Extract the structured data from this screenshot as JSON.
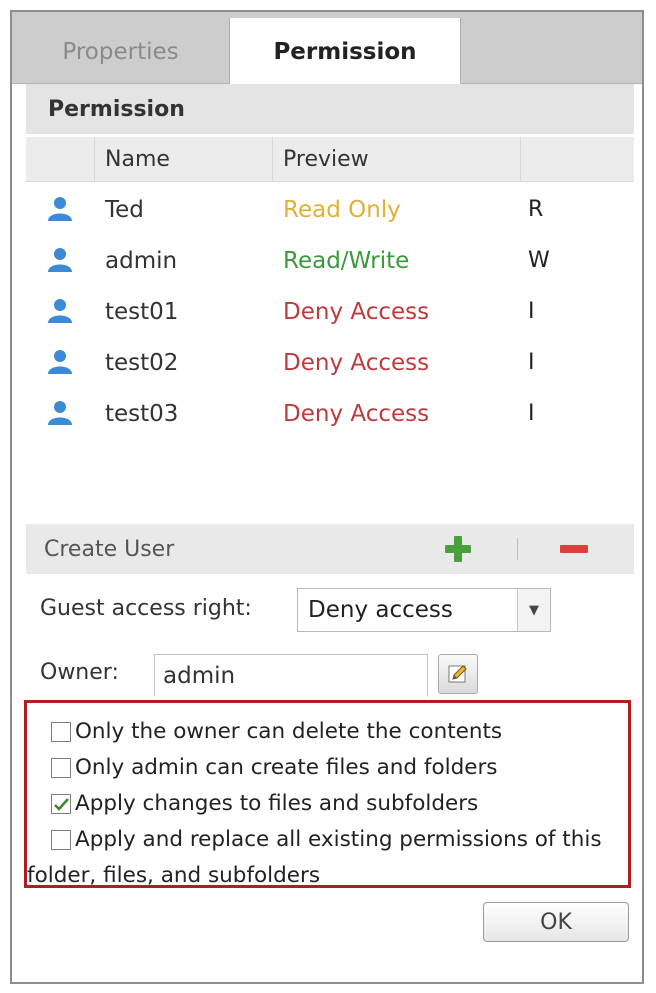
{
  "tabs": [
    {
      "label": "Properties"
    },
    {
      "label": "Permission"
    }
  ],
  "section_title": "Permission",
  "table": {
    "columns": [
      "Name",
      "Preview",
      ""
    ],
    "rows": [
      {
        "name": "Ted",
        "preview": "Read Only",
        "permission": "R",
        "preview_color": "#e0b132"
      },
      {
        "name": "admin",
        "preview": "Read/Write",
        "permission": "W",
        "preview_color": "#3a9a3a"
      },
      {
        "name": "test01",
        "preview": "Deny Access",
        "permission": "I",
        "preview_color": "#c0393b"
      },
      {
        "name": "test02",
        "preview": "Deny Access",
        "permission": "I",
        "preview_color": "#c0393b"
      },
      {
        "name": "test03",
        "preview": "Deny Access",
        "permission": "I",
        "preview_color": "#c0393b"
      }
    ]
  },
  "toolbar": {
    "label": "Create User",
    "add_icon": "plus-icon",
    "remove_icon": "minus-icon"
  },
  "guest_access": {
    "label": "Guest access right:",
    "value": "Deny access"
  },
  "owner": {
    "label": "Owner:",
    "value": "admin",
    "edit_icon": "edit-icon"
  },
  "options": [
    {
      "label": "Only the owner can delete the contents",
      "checked": false
    },
    {
      "label": "Only admin can create files and folders",
      "checked": false
    },
    {
      "label": "Apply changes to files and subfolders",
      "checked": true
    },
    {
      "label_line1": "Apply and replace all existing permissions of this",
      "label_line2": "folder, files, and subfolders",
      "checked": false
    }
  ],
  "ok_label": "OK",
  "colors": {
    "accent_red_outline": "#b01e23",
    "user_icon": "#3c8ad6",
    "add_icon": "#4aa03a",
    "remove_icon": "#d9413a"
  }
}
